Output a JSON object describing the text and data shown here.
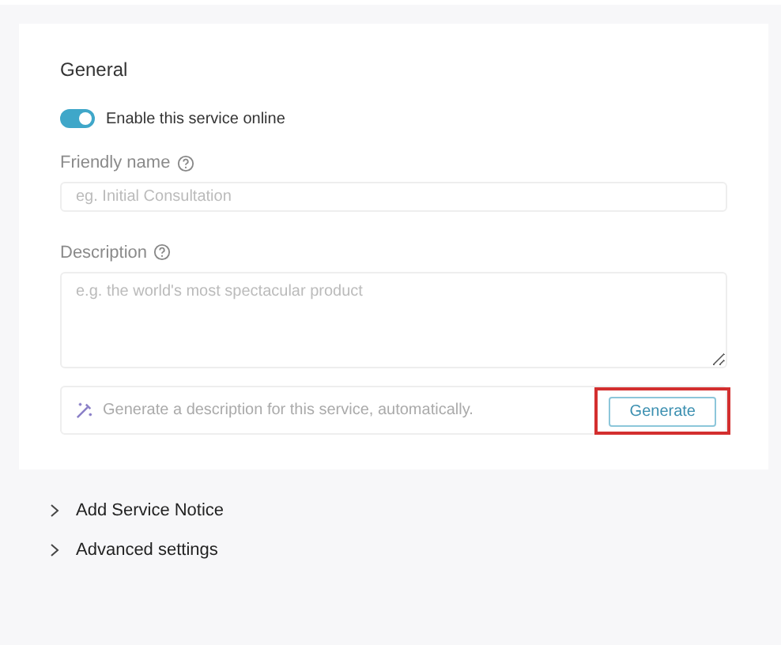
{
  "section_title": "General",
  "online_toggle": {
    "label": "Enable this service online",
    "on": true
  },
  "friendly_name": {
    "label": "Friendly name",
    "placeholder": "eg. Initial Consultation"
  },
  "description": {
    "label": "Description",
    "placeholder": "e.g. the world's most spectacular product"
  },
  "generate_bar": {
    "text": "Generate a description for this service, automatically.",
    "button": "Generate",
    "highlighted": true
  },
  "collapsibles": [
    {
      "label": "Add Service Notice",
      "expanded": false
    },
    {
      "label": "Advanced settings",
      "expanded": false
    }
  ]
}
